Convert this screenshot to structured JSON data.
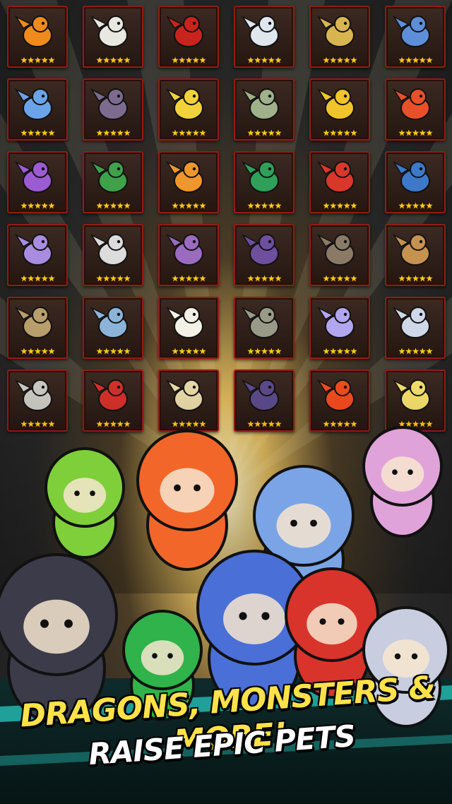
{
  "banner": {
    "headline": "DRAGONS, MONSTERS & MORE!",
    "subheadline": "RAISE EPIC PETS"
  },
  "colors": {
    "headline": "#ffe24a",
    "subheadline": "#ffffff",
    "card_border": "#8f1e14",
    "star": "#ffcc1a"
  },
  "pet_rating_stars": 5,
  "star_glyph": "★★★★★",
  "pet_cards": [
    {
      "icon": "pumpkin-pet-icon",
      "color": "#f08a1c"
    },
    {
      "icon": "zebra-unicorn-pet-icon",
      "color": "#e8e8e0"
    },
    {
      "icon": "red-devil-pet-icon",
      "color": "#c8231d"
    },
    {
      "icon": "snowman-pet-icon",
      "color": "#dfe6ee"
    },
    {
      "icon": "golden-dragon-pet-icon",
      "color": "#d9b552"
    },
    {
      "icon": "blue-wolf-pet-icon",
      "color": "#5d8fd8"
    },
    {
      "icon": "ice-dragon-pet-icon",
      "color": "#6aa3e8"
    },
    {
      "icon": "grim-reaper-pet-icon",
      "color": "#7d6b8f"
    },
    {
      "icon": "lightning-bird-pet-icon",
      "color": "#f2d23a"
    },
    {
      "icon": "tribal-chief-pet-icon",
      "color": "#9fb08a"
    },
    {
      "icon": "moon-fairy-pet-icon",
      "color": "#f2c42b"
    },
    {
      "icon": "phoenix-pet-icon",
      "color": "#e8502a"
    },
    {
      "icon": "jester-pet-icon",
      "color": "#9b5bd3"
    },
    {
      "icon": "green-dragon-pet-icon",
      "color": "#3fa14a"
    },
    {
      "icon": "fire-dragon-pet-icon",
      "color": "#f0962b"
    },
    {
      "icon": "antler-dragon-pet-icon",
      "color": "#2f9f59"
    },
    {
      "icon": "red-phoenix-pet-icon",
      "color": "#d9372a"
    },
    {
      "icon": "totem-pet-icon",
      "color": "#3c79c9"
    },
    {
      "icon": "purple-unicorn-pet-icon",
      "color": "#a98be0"
    },
    {
      "icon": "white-griffin-pet-icon",
      "color": "#dcdcdc"
    },
    {
      "icon": "serpent-pet-icon",
      "color": "#9a6bbf"
    },
    {
      "icon": "shadow-dragon-pet-icon",
      "color": "#6e4f9e"
    },
    {
      "icon": "crow-pet-icon",
      "color": "#8a7a66"
    },
    {
      "icon": "griffin-pet-icon",
      "color": "#c6924f"
    },
    {
      "icon": "sand-beast-pet-icon",
      "color": "#b79e6a"
    },
    {
      "icon": "frost-spirit-pet-icon",
      "color": "#8cb4d8"
    },
    {
      "icon": "white-eagle-pet-icon",
      "color": "#f3f1e6"
    },
    {
      "icon": "stone-golem-pet-icon",
      "color": "#9a9a88"
    },
    {
      "icon": "winged-fish-pet-icon",
      "color": "#b2a6f0"
    },
    {
      "icon": "ice-lion-pet-icon",
      "color": "#cfd8e8"
    },
    {
      "icon": "gray-gargoyle-pet-icon",
      "color": "#c8c8c0"
    },
    {
      "icon": "crimson-dragon-pet-icon",
      "color": "#d2302a"
    },
    {
      "icon": "cream-owl-pet-icon",
      "color": "#e6d7a8"
    },
    {
      "icon": "arrow-raven-pet-icon",
      "color": "#5b4a8a"
    },
    {
      "icon": "flame-spirit-pet-icon",
      "color": "#ef4a1e"
    },
    {
      "icon": "yellow-cat-pet-icon",
      "color": "#f0dc6c"
    }
  ],
  "heroes": [
    {
      "icon": "parrot-pet-icon",
      "color": "#7fcf3b"
    },
    {
      "icon": "fire-hair-hero-icon",
      "color": "#f2662a"
    },
    {
      "icon": "ice-hero-icon",
      "color": "#7aa4e6"
    },
    {
      "icon": "horned-demon-hero-icon",
      "color": "#e0a3d9"
    },
    {
      "icon": "top-hat-skeleton-hero-icon",
      "color": "#3b3b4a"
    },
    {
      "icon": "seahorse-pet-icon",
      "color": "#2fb34a"
    },
    {
      "icon": "wizard-cat-hero-icon",
      "color": "#4a6fd6"
    },
    {
      "icon": "red-hair-hero-icon",
      "color": "#d8342c"
    },
    {
      "icon": "spartan-hero-icon",
      "color": "#c8cde0"
    }
  ]
}
